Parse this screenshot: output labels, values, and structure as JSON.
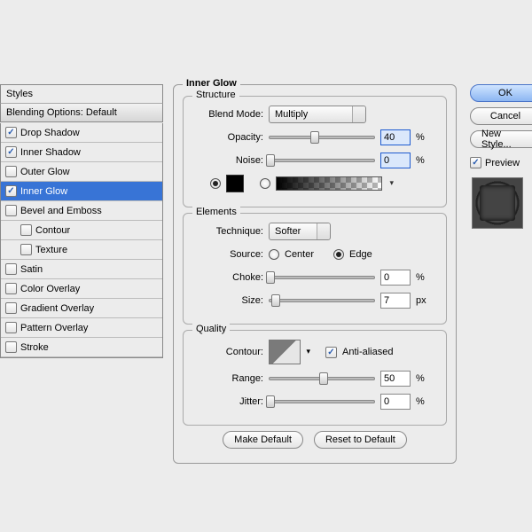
{
  "styles_header": "Styles",
  "blending_default": "Blending Options: Default",
  "effects": [
    {
      "label": "Drop Shadow",
      "checked": true,
      "sub": false
    },
    {
      "label": "Inner Shadow",
      "checked": true,
      "sub": false
    },
    {
      "label": "Outer Glow",
      "checked": false,
      "sub": false
    },
    {
      "label": "Inner Glow",
      "checked": true,
      "sub": false,
      "selected": true
    },
    {
      "label": "Bevel and Emboss",
      "checked": false,
      "sub": false
    },
    {
      "label": "Contour",
      "checked": false,
      "sub": true
    },
    {
      "label": "Texture",
      "checked": false,
      "sub": true
    },
    {
      "label": "Satin",
      "checked": false,
      "sub": false
    },
    {
      "label": "Color Overlay",
      "checked": false,
      "sub": false
    },
    {
      "label": "Gradient Overlay",
      "checked": false,
      "sub": false
    },
    {
      "label": "Pattern Overlay",
      "checked": false,
      "sub": false
    },
    {
      "label": "Stroke",
      "checked": false,
      "sub": false
    }
  ],
  "panel_title": "Inner Glow",
  "structure": {
    "title": "Structure",
    "blend_mode_label": "Blend Mode:",
    "blend_mode_value": "Multiply",
    "opacity_label": "Opacity:",
    "opacity_value": "40",
    "noise_label": "Noise:",
    "noise_value": "0",
    "percent": "%",
    "swatch_color": "#000000"
  },
  "elements": {
    "title": "Elements",
    "technique_label": "Technique:",
    "technique_value": "Softer",
    "source_label": "Source:",
    "center_label": "Center",
    "edge_label": "Edge",
    "choke_label": "Choke:",
    "choke_value": "0",
    "size_label": "Size:",
    "size_value": "7",
    "percent": "%",
    "px": "px"
  },
  "quality": {
    "title": "Quality",
    "contour_label": "Contour:",
    "anti_alias": "Anti-aliased",
    "range_label": "Range:",
    "range_value": "50",
    "jitter_label": "Jitter:",
    "jitter_value": "0",
    "percent": "%"
  },
  "buttons": {
    "make_default": "Make Default",
    "reset_default": "Reset to Default",
    "ok": "OK",
    "cancel": "Cancel",
    "new_style": "New Style...",
    "preview": "Preview"
  }
}
